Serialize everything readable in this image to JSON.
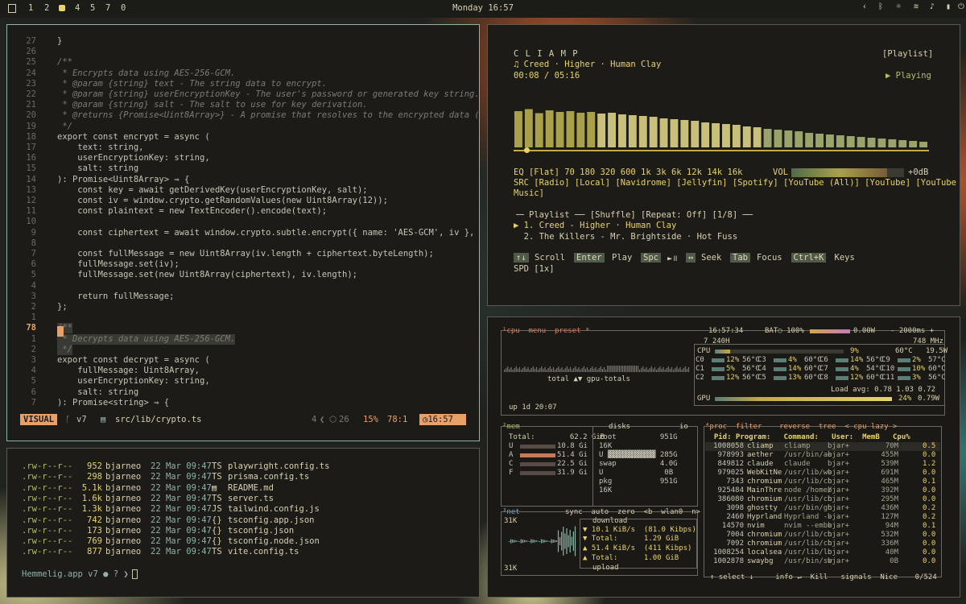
{
  "topbar": {
    "workspaces": [
      "1",
      "2",
      "4",
      "5",
      "7",
      "0"
    ],
    "clock": "Monday 16:57",
    "tray_icons": [
      "chevron-left-icon",
      "bluetooth-icon",
      "brightness-icon",
      "wifi-icon",
      "volume-icon",
      "battery-icon",
      "power-icon"
    ]
  },
  "editor": {
    "lines": [
      {
        "n": "27",
        "c": "}"
      },
      {
        "n": "26",
        "c": ""
      },
      {
        "n": "25",
        "c": "/**"
      },
      {
        "n": "24",
        "c": " * Encrypts data using AES-256-GCM."
      },
      {
        "n": "23",
        "c": " * @param {string} text - The string data to encrypt."
      },
      {
        "n": "22",
        "c": " * @param {string} userEncryptionKey - The user's password or generated key string."
      },
      {
        "n": "21",
        "c": " * @param {string} salt - The salt to use for key derivation."
      },
      {
        "n": "20",
        "c": " * @returns {Promise<Uint8Array>} - A promise that resolves to the encrypted data (IV"
      },
      {
        "n": "19",
        "c": " */"
      },
      {
        "n": "18",
        "c": "export const encrypt = async ("
      },
      {
        "n": "17",
        "c": "    text: string,"
      },
      {
        "n": "16",
        "c": "    userEncryptionKey: string,"
      },
      {
        "n": "15",
        "c": "    salt: string"
      },
      {
        "n": "14",
        "c": "): Promise<Uint8Array> ⇒ {"
      },
      {
        "n": "13",
        "c": "    const key = await getDerivedKey(userEncryptionKey, salt);"
      },
      {
        "n": "12",
        "c": "    const iv = window.crypto.getRandomValues(new Uint8Array(12));"
      },
      {
        "n": "11",
        "c": "    const plaintext = new TextEncoder().encode(text);"
      },
      {
        "n": "10",
        "c": ""
      },
      {
        "n": "9",
        "c": "    const ciphertext = await window.crypto.subtle.encrypt({ name: 'AES-GCM', iv }, key"
      },
      {
        "n": "8",
        "c": ""
      },
      {
        "n": "7",
        "c": "    const fullMessage = new Uint8Array(iv.length + ciphertext.byteLength);"
      },
      {
        "n": "6",
        "c": "    fullMessage.set(iv);"
      },
      {
        "n": "5",
        "c": "    fullMessage.set(new Uint8Array(ciphertext), iv.length);"
      },
      {
        "n": "4",
        "c": ""
      },
      {
        "n": "3",
        "c": "    return fullMessage;"
      },
      {
        "n": "2",
        "c": "};"
      },
      {
        "n": "1",
        "c": ""
      },
      {
        "n": "78",
        "c": "/**"
      },
      {
        "n": "1",
        "c": " * Decrypts data using AES-256-GCM."
      },
      {
        "n": "2",
        "c": " */"
      },
      {
        "n": "3",
        "c": "export const decrypt = async ("
      },
      {
        "n": "4",
        "c": "    fullMessage: Uint8Array,"
      },
      {
        "n": "5",
        "c": "    userEncryptionKey: string,"
      },
      {
        "n": "6",
        "c": "    salt: string"
      },
      {
        "n": "7",
        "c": "): Promise<string> ⇒ {"
      }
    ],
    "status": {
      "mode": "VISUAL",
      "branch": "v7",
      "file": "src/lib/crypto.ts",
      "diag": "4",
      "files": "26",
      "percent": "15%",
      "pos": "78:1",
      "time": "16:57"
    }
  },
  "files": {
    "rows": [
      {
        "perm": ".rw-r--r--",
        "size": "952",
        "user": "bjarneo",
        "date": "22 Mar 09:47",
        "icon": "TS",
        "name": "playwright.config.ts"
      },
      {
        "perm": ".rw-r--r--",
        "size": "298",
        "user": "bjarneo",
        "date": "22 Mar 09:47",
        "icon": "TS",
        "name": "prisma.config.ts"
      },
      {
        "perm": ".rw-r--r--",
        "size": "5.1k",
        "user": "bjarneo",
        "date": "22 Mar 09:47",
        "icon": "▤",
        "name": "README.md"
      },
      {
        "perm": ".rw-r--r--",
        "size": "1.6k",
        "user": "bjarneo",
        "date": "22 Mar 09:47",
        "icon": "TS",
        "name": "server.ts"
      },
      {
        "perm": ".rw-r--r--",
        "size": "1.3k",
        "user": "bjarneo",
        "date": "22 Mar 09:47",
        "icon": "JS",
        "name": "tailwind.config.js"
      },
      {
        "perm": ".rw-r--r--",
        "size": "742",
        "user": "bjarneo",
        "date": "22 Mar 09:47",
        "icon": "{}",
        "name": "tsconfig.app.json"
      },
      {
        "perm": ".rw-r--r--",
        "size": "173",
        "user": "bjarneo",
        "date": "22 Mar 09:47",
        "icon": "{}",
        "name": "tsconfig.json"
      },
      {
        "perm": ".rw-r--r--",
        "size": "769",
        "user": "bjarneo",
        "date": "22 Mar 09:47",
        "icon": "{}",
        "name": "tsconfig.node.json"
      },
      {
        "perm": ".rw-r--r--",
        "size": "877",
        "user": "bjarneo",
        "date": "22 Mar 09:47",
        "icon": "TS",
        "name": "vite.config.ts"
      }
    ],
    "prompt": "Hemmelig.app v7 ● ? ❯"
  },
  "player": {
    "title": "C L I A M P",
    "track": "♫ Creed · Higher · Human Clay",
    "time": "00:08 / 05:16",
    "playlist_btn": "[Playlist]",
    "state": "▶ Playing",
    "progress": 0.025,
    "spectrum": [
      0.9,
      0.95,
      0.85,
      0.92,
      0.88,
      0.9,
      0.86,
      0.88,
      0.84,
      0.86,
      0.82,
      0.8,
      0.78,
      0.76,
      0.72,
      0.7,
      0.68,
      0.66,
      0.62,
      0.6,
      0.58,
      0.56,
      0.52,
      0.5,
      0.46,
      0.44,
      0.42,
      0.4,
      0.36,
      0.34,
      0.32,
      0.3,
      0.28,
      0.26,
      0.24,
      0.22,
      0.2,
      0.18,
      0.16,
      0.14
    ],
    "eq": "EQ [Flat] 70 180 320 600 1k 3k 6k 12k 14k 16k",
    "vol_label": "VOL",
    "vol_value": "+0dB",
    "volume": 0.85,
    "src": "SRC [Radio] [Local] [Navidrome] [Jellyfin] [Spotify] [YouTube (All)] [YouTube] [YouTube",
    "src2": "Music]",
    "playlist_header": "╶─ Playlist ── [Shuffle] [Repeat: Off] [1/8] ──",
    "items": [
      "▶ 1. Creed - Higher · Human Clay",
      "  2. The Killers - Mr. Brightside · Hot Fuss"
    ],
    "keys": [
      {
        "k": "↑↓",
        "l": "Scroll"
      },
      {
        "k": "Enter",
        "l": "Play"
      },
      {
        "k": "Spc",
        "l": "►॥"
      },
      {
        "k": "↔",
        "l": "Seek"
      },
      {
        "k": "Tab",
        "l": "Focus"
      },
      {
        "k": "Ctrl+K",
        "l": "Keys"
      }
    ],
    "spd": "SPD [1x]"
  },
  "btop": {
    "cpu_header": "¹cpu  menu  preset *",
    "clock": "16:57:34",
    "bat": "BAT○ 100%",
    "power": "0.00W",
    "interval": "- 2000ms +",
    "cpu_model": "7 240H",
    "cpu_mhz": "748 MHz",
    "cpu_total": {
      "label": "CPU",
      "pct": "9%",
      "temp": "60°C",
      "watt": "19.5W"
    },
    "cores": [
      [
        "C0",
        "12%",
        "56°C"
      ],
      [
        "C1",
        "5%",
        "56°C"
      ],
      [
        "C2",
        "12%",
        "56°C"
      ],
      [
        "C3",
        "4%",
        "60°C"
      ],
      [
        "C4",
        "14%",
        "60°C"
      ],
      [
        "C5",
        "13%",
        "60°C"
      ],
      [
        "C6",
        "14%",
        "56°C"
      ],
      [
        "C7",
        "4%",
        "54°C"
      ],
      [
        "C8",
        "12%",
        "60°C"
      ],
      [
        "C9",
        "2%",
        "57°C"
      ],
      [
        "C10",
        "10%",
        "60°C"
      ],
      [
        "C11",
        "3%",
        "56°C"
      ]
    ],
    "load": "Load avg: 0.78 1.03 0.72",
    "gpu": {
      "label": "GPU",
      "pct": "24%",
      "watt": "0.79W"
    },
    "graph_label": "total ▲▼ gpu-totals",
    "uptime": "up 1d 20:07",
    "mem": {
      "title": "²mem",
      "total": "Total:        62.2 GiB",
      "rows": [
        [
          "U",
          "10.8 Gi"
        ],
        [
          "A",
          "51.4 Gi"
        ],
        [
          "C",
          "22.5 Gi"
        ],
        [
          "F",
          "31.9 Gi"
        ]
      ]
    },
    "disks": {
      "title": "disks",
      "io": "io",
      "rows": [
        "root          951G",
        "16K",
        "U ▓▓▓▓▓▓▓▓▓▓▓ 285G",
        "swap          4.0G",
        "U              0B",
        "pkg           951G",
        "16K"
      ]
    },
    "proc": {
      "title": "⁴proc  filter    reverse  tree  < cpu lazy >",
      "header": "  Pid: Program:   Command:   User:  MemB   Cpu%",
      "rows": [
        [
          "1008058",
          "cliamp",
          "cliamp",
          "bjar+",
          "70M",
          "0.5"
        ],
        [
          "978993",
          "aether",
          "/usr/bin/ae",
          "bjar+",
          "455M",
          "0.0"
        ],
        [
          "849812",
          "claude",
          "claude",
          "bjar+",
          "539M",
          "1.2"
        ],
        [
          "979025",
          "WebKitNe",
          "/usr/lib/we",
          "bjar+",
          "691M",
          "0.0"
        ],
        [
          "7343",
          "chromium",
          "/usr/lib/ch",
          "bjar+",
          "465M",
          "0.1"
        ],
        [
          "925484",
          "MainThre",
          "node /home/",
          "bjar+",
          "392M",
          "0.0"
        ],
        [
          "386080",
          "chromium",
          "/usr/lib/ch",
          "bjar+",
          "295M",
          "0.0"
        ],
        [
          "3098",
          "ghostty",
          "/usr/bin/gh",
          "bjar+",
          "436M",
          "0.2"
        ],
        [
          "2460",
          "Hyprland",
          "Hyprland --",
          "bjar+",
          "127M",
          "0.2"
        ],
        [
          "14570",
          "nvim",
          "nvim --embe",
          "bjar+",
          "94M",
          "0.1"
        ],
        [
          "7004",
          "chromium",
          "/usr/lib/ch",
          "bjar+",
          "532M",
          "0.0"
        ],
        [
          "7092",
          "chromium",
          "/usr/lib/ch",
          "bjar+",
          "336M",
          "0.0"
        ],
        [
          "1008254",
          "localsea",
          "/usr/lib/lo",
          "bjar+",
          "40M",
          "0.0"
        ],
        [
          "1002878",
          "swaybg",
          "/usr/bin/sw",
          "bjar+",
          "0B",
          "0.0"
        ]
      ],
      "footer": "↑ select ↓     info ↵  Kill   signals  Nice    0/524"
    },
    "net": {
      "title": "³net",
      "menu": "sync  auto  zero  <b  wlan0  n>",
      "scale_top": "31K",
      "scale_bot": "31K",
      "download_label": "download",
      "down_rate": "▼ 10.1 KiB/s  (81.0 Kibps)",
      "down_total": "▼ Total:      1.29 GiB",
      "up_rate": "▲ 51.4 KiB/s  (411 Kibps)",
      "up_total": "▲ Total:      1.00 GiB",
      "upload_label": "upload"
    }
  }
}
